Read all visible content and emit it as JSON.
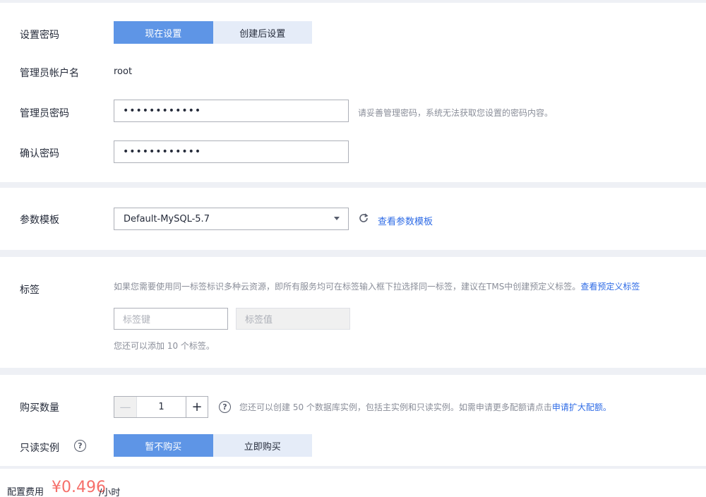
{
  "password": {
    "label": "设置密码",
    "option_now": "现在设置",
    "option_later": "创建后设置",
    "admin_account_label": "管理员帐户名",
    "admin_account_value": "root",
    "admin_password_label": "管理员密码",
    "admin_password_value": "••••••••••••",
    "admin_password_hint": "请妥善管理密码，系统无法获取您设置的密码内容。",
    "confirm_label": "确认密码",
    "confirm_value": "••••••••••••"
  },
  "params": {
    "label": "参数模板",
    "selected": "Default-MySQL-5.7",
    "view_link": "查看参数模板",
    "icon": "refresh-icon"
  },
  "tags": {
    "label": "标签",
    "description": "如果您需要使用同一标签标识多种云资源，即所有服务均可在标签输入框下拉选择同一标签，建议在TMS中创建预定义标签。",
    "view_link": "查看预定义标签",
    "key_placeholder": "标签键",
    "value_placeholder": "标签值",
    "remaining": "您还可以添加 10 个标签。"
  },
  "purchase": {
    "label": "购买数量",
    "minus": "—",
    "quantity": "1",
    "plus": "+",
    "hint": "您还可以创建 50 个数据库实例，包括主实例和只读实例。如需申请更多配额请点击",
    "hint_link": "申请扩大配额。",
    "readonly_label": "只读实例",
    "readonly_no": "暂不购买",
    "readonly_now": "立即购买"
  },
  "footer": {
    "fee_label": "配置费用",
    "price": "¥0.496",
    "unit": "/小时"
  },
  "colors": {
    "primary": "#5e95e6",
    "link": "#2e6be6",
    "price": "#f66f6a"
  }
}
